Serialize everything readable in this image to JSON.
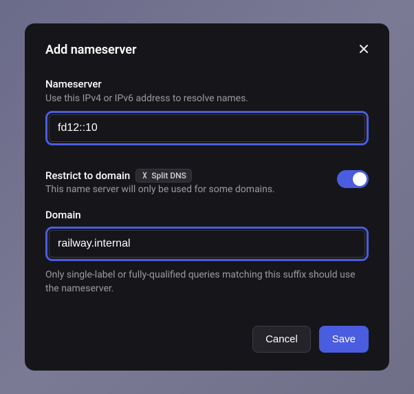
{
  "modal": {
    "title": "Add nameserver"
  },
  "nameserver": {
    "label": "Nameserver",
    "hint": "Use this IPv4 or IPv6 address to resolve names.",
    "value": "fd12::10"
  },
  "restrict": {
    "label": "Restrict to domain",
    "badge": "Split DNS",
    "hint": "This name server will only be used for some domains.",
    "enabled": true
  },
  "domain": {
    "label": "Domain",
    "value": "railway.internal",
    "helper": "Only single-label or fully-qualified queries matching this suffix should use the nameserver."
  },
  "buttons": {
    "cancel": "Cancel",
    "save": "Save"
  }
}
